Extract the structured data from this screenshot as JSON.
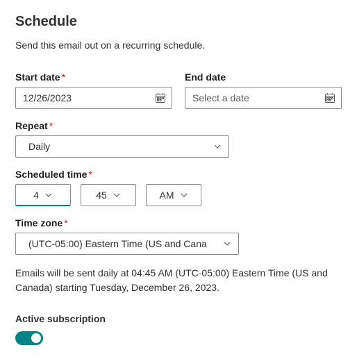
{
  "heading": "Schedule",
  "subtitle": "Send this email out on a recurring schedule.",
  "start_date": {
    "label": "Start date",
    "value": "12/26/2023"
  },
  "end_date": {
    "label": "End date",
    "placeholder": "Select a date"
  },
  "repeat": {
    "label": "Repeat",
    "value": "Daily"
  },
  "scheduled_time": {
    "label": "Scheduled time",
    "hour": "4",
    "minute": "45",
    "ampm": "AM"
  },
  "time_zone": {
    "label": "Time zone",
    "value": "(UTC-05:00) Eastern Time (US and Cana"
  },
  "summary": "Emails will be sent daily at 04:45 AM (UTC-05:00) Eastern Time (US and Canada) starting Tuesday, December 26, 2023.",
  "active_subscription": {
    "label": "Active subscription",
    "on": true
  },
  "required_mark": "*"
}
